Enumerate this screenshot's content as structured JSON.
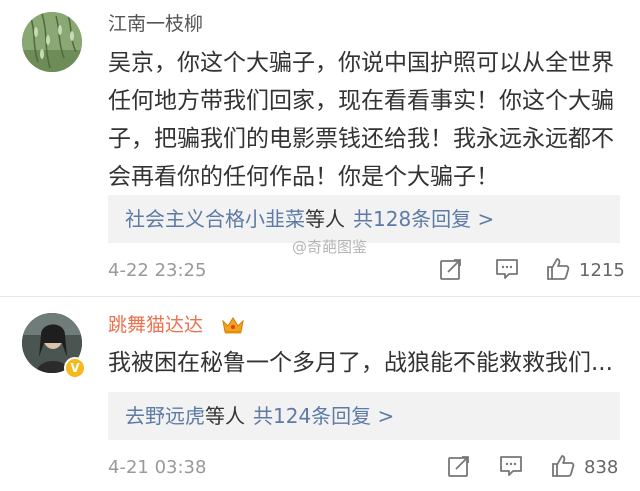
{
  "comments": [
    {
      "username": "江南一枝柳",
      "text": "吴京，你这个大骗子，你说中国护照可以从全世界任何地方带我们回家，现在看看事实！你这个大骗子，把骗我们的电影票钱还给我！我永远永远都不会再看你的任何作品！你是个大骗子！",
      "reply_users": "社会主义合格小韭菜",
      "reply_suffix": "等人",
      "reply_count": "共128条回复 >",
      "time": "4-22 23:25",
      "likes": "1215",
      "icons": [
        "repost-icon",
        "comment-icon",
        "like-icon"
      ]
    },
    {
      "username": "跳舞猫达达",
      "badge": "V",
      "text": "我被困在秘鲁一个多月了，战狼能不能救救我们...",
      "reply_users": "去野远虎",
      "reply_suffix": "等人",
      "reply_count": "共124条回复 >",
      "time": "4-21 03:38",
      "likes": "838",
      "icons": [
        "repost-icon",
        "comment-icon",
        "like-icon"
      ]
    }
  ],
  "watermark": "@奇葩图鉴",
  "colors": {
    "username_vip": "#eb7350",
    "link": "#5d7ba6",
    "reply_bg": "#f2f2f2",
    "meta": "#999999"
  }
}
